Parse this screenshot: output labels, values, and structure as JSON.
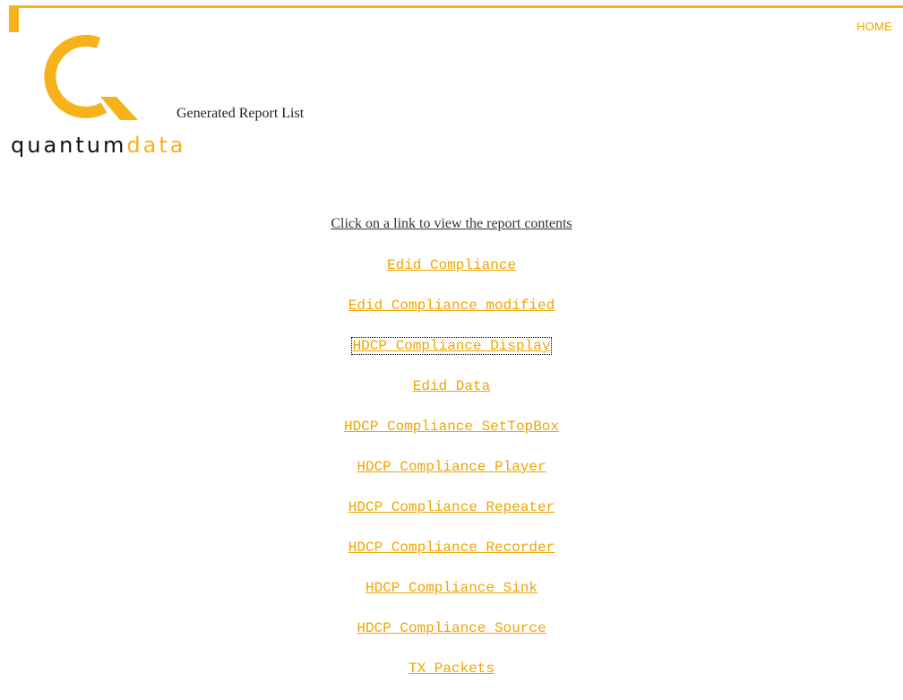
{
  "header": {
    "home_label": "HOME"
  },
  "logo": {
    "word_dark": "quantum",
    "word_accent": "data",
    "brand_color": "#f6b21b",
    "logo_icon": "q-logo-icon"
  },
  "page": {
    "heading": "Generated Report List",
    "instructions": "Click on a link to view the report contents",
    "focused_report_index": 2
  },
  "reports": [
    {
      "label": "Edid Compliance"
    },
    {
      "label": "Edid Compliance modified"
    },
    {
      "label": "HDCP Compliance Display"
    },
    {
      "label": "Edid Data"
    },
    {
      "label": "HDCP Compliance SetTopBox"
    },
    {
      "label": "HDCP Compliance Player"
    },
    {
      "label": "HDCP Compliance Repeater"
    },
    {
      "label": "HDCP Compliance Recorder"
    },
    {
      "label": "HDCP Compliance Sink"
    },
    {
      "label": "HDCP Compliance Source"
    },
    {
      "label": "TX Packets"
    }
  ]
}
